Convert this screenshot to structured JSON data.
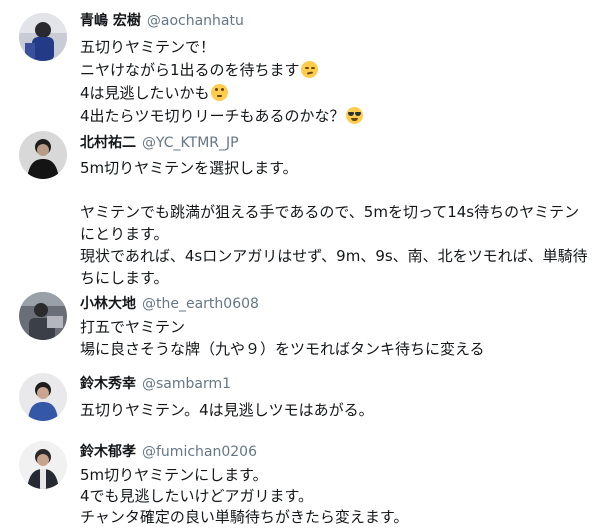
{
  "tweets": [
    {
      "name": "青嶋 宏樹",
      "handle": "@aochanhatu",
      "lines": [
        "五切りヤミテンで！",
        "ニヤけながら1出るのを待ちます",
        "4は見逃したいかも",
        "4出たらツモ切りリーチもあるのかな？"
      ],
      "emoji": [
        "smirking-face",
        "face-with-rolling-eyes",
        "smiling-face-with-sunglasses"
      ]
    },
    {
      "name": "北村祐二",
      "handle": "@YC_KTMR_JP",
      "lines": [
        "5m切りヤミテンを選択します。",
        "",
        "ヤミテンでも跳満が狙える手であるので、5mを切って14s待ちのヤミテン",
        "にとります。",
        "現状であれば、4sロンアガリはせず、9m、9s、南、北をツモれば、単騎待",
        "ちにします。"
      ]
    },
    {
      "name": "小林大地",
      "handle": "@the_earth0608",
      "lines": [
        "打五でヤミテン",
        "場に良さそうな牌（九や９）をツモればタンキ待ちに変える"
      ]
    },
    {
      "name": "鈴木秀幸",
      "handle": "@sambarm1",
      "lines": [
        "五切りヤミテン。4は見逃しツモはあがる。"
      ]
    },
    {
      "name": "鈴木郁孝",
      "handle": "@fumichan0206",
      "lines": [
        "5m切りヤミテンにします。",
        "4でも見逃したいけどアガリます。",
        "チャンタ確定の良い単騎待ちがきたら変えます。"
      ]
    }
  ],
  "colors": {
    "text": "#14171a",
    "handle": "#657786",
    "background": "#ffffff",
    "emoji_face": "#ffcc4d"
  }
}
